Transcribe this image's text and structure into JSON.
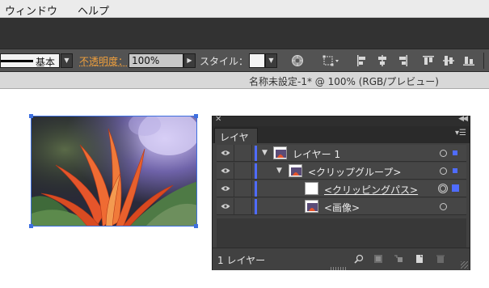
{
  "menubar": {
    "items": [
      "ウィンドウ",
      "ヘルプ"
    ]
  },
  "controlbar": {
    "stroke_style_label": "基本",
    "opacity_label": "不透明度：",
    "opacity_value": "100%",
    "style_label": "スタイル：",
    "icons": [
      "recolor-artwork-icon",
      "transform-icon",
      "align-left-icon",
      "align-horizontal-center-icon",
      "align-right-icon",
      "align-top-icon",
      "align-vertical-center-icon",
      "align-bottom-icon"
    ]
  },
  "document": {
    "title": "名称未設定-1* @ 100% (RGB/プレビュー)"
  },
  "artwork": {
    "description_colors": {
      "selection": "#3d6fe0"
    }
  },
  "layers_panel": {
    "tab_label": "レイヤー",
    "rows": [
      {
        "name": "レイヤー 1",
        "expanded": true,
        "underline": false
      },
      {
        "name": "<クリップグループ>",
        "expanded": true,
        "underline": false
      },
      {
        "name": "<クリッピングパス>",
        "expanded": false,
        "underline": true
      },
      {
        "name": "<画像>",
        "expanded": false,
        "underline": false
      }
    ],
    "layer_count": "1 レイヤー",
    "footer_icons": [
      "locate-object-icon",
      "make-clipping-mask-icon",
      "create-sublayer-icon",
      "new-layer-icon",
      "trash-icon"
    ],
    "colors": {
      "layer_color": "#4f6cff"
    }
  }
}
